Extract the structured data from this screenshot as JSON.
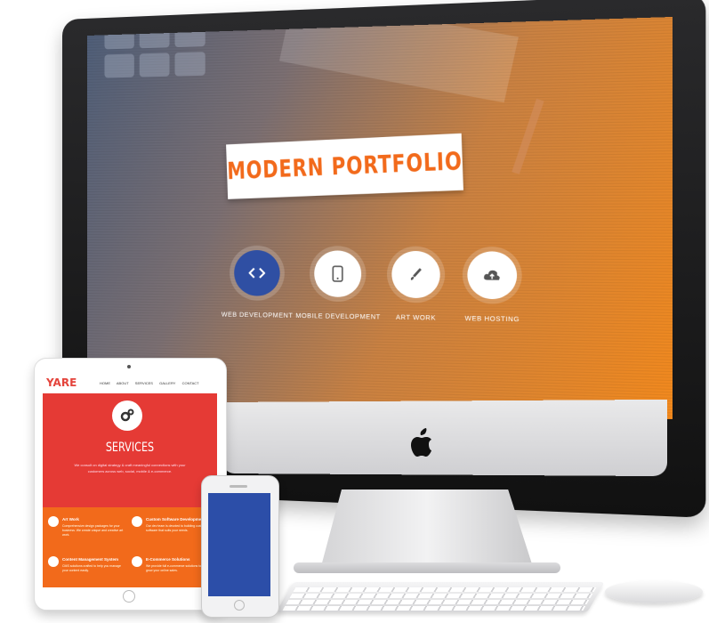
{
  "desktop": {
    "hero_title": "MODERN PORTFOLIO",
    "services": [
      {
        "label": "WEB DEVELOPMENT",
        "icon": "code-icon",
        "active": true
      },
      {
        "label": "MOBILE DEVELOPMENT",
        "icon": "mobile-icon",
        "active": false
      },
      {
        "label": "ART WORK",
        "icon": "brush-icon",
        "active": false
      },
      {
        "label": "WEB HOSTING",
        "icon": "cloud-upload-icon",
        "active": false
      }
    ]
  },
  "tablet": {
    "logo": "YARE",
    "nav": [
      "HOME",
      "ABOUT",
      "SERVICES",
      "GALLERY",
      "CONTACT"
    ],
    "section_title": "SERVICES",
    "section_desc_1": "We consult on digital strategy & craft meaningful connections with your",
    "section_desc_2": "customers across web, social, mobile & e-commerce.",
    "features": [
      {
        "title": "Art Work",
        "desc": "Comprehensive design packages for your business. We create unique and creative art work.",
        "icon": "brush-icon"
      },
      {
        "title": "Custom Software Development",
        "desc": "Our dev team is devoted to building custom software that suits your needs.",
        "icon": "gear-icon"
      },
      {
        "title": "Content Management System",
        "desc": "CMS solutions crafted to help you manage your content easily.",
        "icon": "settings-icon"
      },
      {
        "title": "E-Commerce Solutions",
        "desc": "We provide full e-commerce solutions to grow your online sales.",
        "icon": "cart-icon"
      }
    ]
  },
  "colors": {
    "accent_orange": "#f26a1b",
    "accent_red": "#e53a35",
    "accent_blue": "#2f4fa3"
  }
}
